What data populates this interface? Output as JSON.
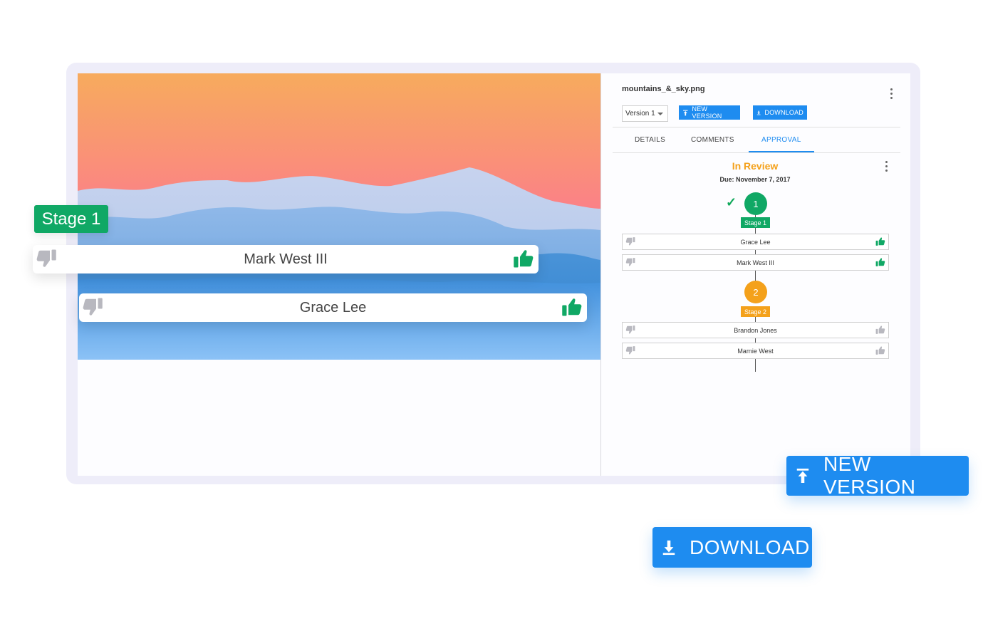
{
  "file": {
    "name": "mountains_&_sky.png"
  },
  "toolbar": {
    "version_value": "Version 1",
    "new_version_label": "NEW VERSION",
    "download_label": "DOWNLOAD"
  },
  "tabs": [
    {
      "label": "DETAILS"
    },
    {
      "label": "COMMENTS"
    },
    {
      "label": "APPROVAL",
      "active": true
    }
  ],
  "approval": {
    "status": "In Review",
    "due": "Due:  November 7, 2017",
    "stages": [
      {
        "number": "1",
        "label": "Stage 1",
        "color": "#10a865",
        "completed": true,
        "reviewers": [
          {
            "name": "Grace Lee",
            "approved": true
          },
          {
            "name": "Mark West III",
            "approved": true
          }
        ]
      },
      {
        "number": "2",
        "label": "Stage 2",
        "color": "#f4a11b",
        "completed": false,
        "reviewers": [
          {
            "name": "Brandon Jones",
            "approved": false
          },
          {
            "name": "Marnie West",
            "approved": false
          }
        ]
      }
    ]
  },
  "overlay": {
    "stage_badge": "Stage 1",
    "rows": [
      {
        "name": "Mark West III",
        "approved": true
      },
      {
        "name": "Grace Lee",
        "approved": true
      }
    ],
    "new_version_label": "NEW VERSION",
    "download_label": "DOWNLOAD"
  },
  "colors": {
    "accent": "#1e8cf0",
    "approved": "#10a865",
    "pending": "#f4a11b",
    "inactive_icon": "#b8b8bf"
  }
}
